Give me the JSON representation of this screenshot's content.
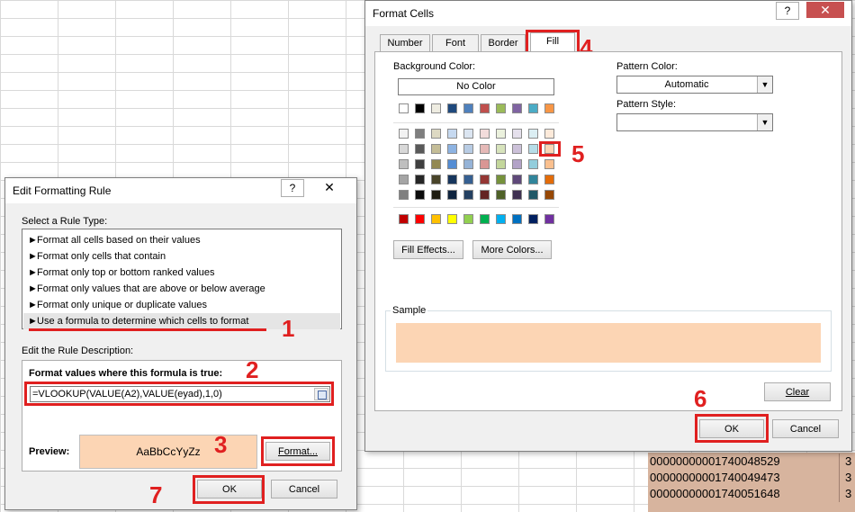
{
  "spreadsheet": {
    "cells": [
      {
        "value": "00000000001740048529",
        "side": "3"
      },
      {
        "value": "00000000001740049473",
        "side": "3"
      },
      {
        "value": "00000000001740051648",
        "side": "3"
      }
    ]
  },
  "format_cells": {
    "title": "Format Cells",
    "tabs": [
      "Number",
      "Font",
      "Border",
      "Fill"
    ],
    "background_color_label": "Background Color:",
    "no_color": "No Color",
    "theme_top_row": [
      "#ffffff",
      "#000000",
      "#eeece1",
      "#1f497d",
      "#4f81bd",
      "#c0504d",
      "#9bbb59",
      "#8064a2",
      "#4bacc6",
      "#f79646"
    ],
    "theme_shades": [
      [
        "#f2f2f2",
        "#7f7f7f",
        "#ddd9c3",
        "#c6d9f0",
        "#dbe5f1",
        "#f2dcdb",
        "#ebf1dd",
        "#e5e0ec",
        "#dbeef3",
        "#fdeada"
      ],
      [
        "#d8d8d8",
        "#595959",
        "#c4bd97",
        "#8db3e2",
        "#b8cce4",
        "#e5b9b7",
        "#d7e3bc",
        "#ccc1d9",
        "#b7dde8",
        "#fbd5b5"
      ],
      [
        "#bfbfbf",
        "#3f3f3f",
        "#938953",
        "#548dd4",
        "#95b3d7",
        "#d99694",
        "#c3d69b",
        "#b2a2c7",
        "#92cddc",
        "#fac08f"
      ],
      [
        "#a5a5a5",
        "#262626",
        "#494429",
        "#17365d",
        "#366092",
        "#953734",
        "#76923c",
        "#5f497a",
        "#31859b",
        "#e36c09"
      ],
      [
        "#7f7f7f",
        "#0c0c0c",
        "#1d1b10",
        "#0f243e",
        "#244061",
        "#632423",
        "#4f6128",
        "#3f3151",
        "#205867",
        "#974806"
      ]
    ],
    "standard_colors": [
      "#c00000",
      "#ff0000",
      "#ffc000",
      "#ffff00",
      "#92d050",
      "#00b050",
      "#00b0f0",
      "#0070c0",
      "#002060",
      "#7030a0"
    ],
    "fill_effects_label": "Fill Effects...",
    "more_colors_label": "More Colors...",
    "pattern_color_label": "Pattern Color:",
    "pattern_color_value": "Automatic",
    "pattern_style_label": "Pattern Style:",
    "pattern_style_value": "",
    "sample_label": "Sample",
    "sample_color": "#fcd5b4",
    "clear_label": "Clear",
    "ok_label": "OK",
    "cancel_label": "Cancel"
  },
  "edit_rule": {
    "title": "Edit Formatting Rule",
    "help": "?",
    "select_rule_type_label": "Select a Rule Type:",
    "rule_types": [
      "Format all cells based on their values",
      "Format only cells that contain",
      "Format only top or bottom ranked values",
      "Format only values that are above or below average",
      "Format only unique or duplicate values",
      "Use a formula to determine which cells to format"
    ],
    "edit_description_label": "Edit the Rule Description:",
    "formula_label": "Format values where this formula is true:",
    "formula_value": "=VLOOKUP(VALUE(A2),VALUE(eyad),1,0)",
    "preview_label": "Preview:",
    "preview_text": "AaBbCcYyZz",
    "preview_color": "#fcd5b4",
    "format_label": "Format...",
    "ok_label": "OK",
    "cancel_label": "Cancel"
  },
  "annotations": [
    "1",
    "2",
    "3",
    "4",
    "5",
    "6",
    "7"
  ]
}
